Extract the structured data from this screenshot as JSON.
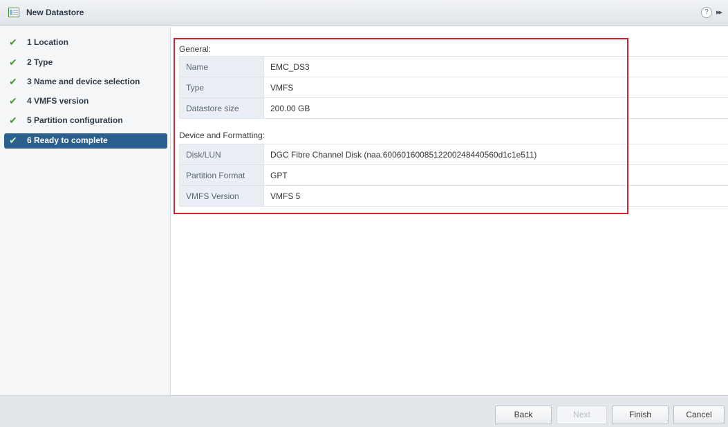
{
  "window": {
    "title": "New Datastore",
    "help_glyph": "?",
    "expand_glyph": "▸▸"
  },
  "steps": [
    {
      "label": "1 Location",
      "completed": true
    },
    {
      "label": "2 Type",
      "completed": true
    },
    {
      "label": "3 Name and device selection",
      "completed": true
    },
    {
      "label": "4 VMFS version",
      "completed": true
    },
    {
      "label": "5 Partition configuration",
      "completed": true
    },
    {
      "label": "6 Ready to complete",
      "completed": true,
      "active": true
    }
  ],
  "check_glyph": "✔",
  "general": {
    "title": "General:",
    "rows": [
      {
        "key": "Name",
        "value": "EMC_DS3"
      },
      {
        "key": "Type",
        "value": "VMFS"
      },
      {
        "key": "Datastore size",
        "value": "200.00 GB"
      }
    ]
  },
  "device": {
    "title": "Device and Formatting:",
    "rows": [
      {
        "key": "Disk/LUN",
        "value": "DGC Fibre Channel Disk (naa.6006016008512200248440560d1c1e511)"
      },
      {
        "key": "Partition Format",
        "value": "GPT"
      },
      {
        "key": "VMFS Version",
        "value": "VMFS 5"
      }
    ]
  },
  "buttons": {
    "back": "Back",
    "next": "Next",
    "finish": "Finish",
    "cancel": "Cancel"
  },
  "colors": {
    "active_step": "#2b5f8e",
    "check": "#4a9b2a",
    "highlight_border": "#d4202a",
    "key_cell": "#e9eff5"
  }
}
